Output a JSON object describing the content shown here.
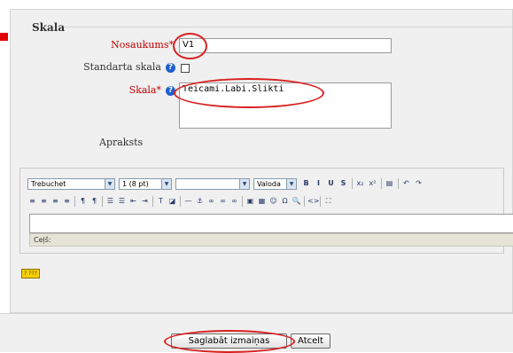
{
  "section": {
    "legend": "Skala"
  },
  "form": {
    "name_label": "Nosaukums",
    "name_value": "V1",
    "standard_label": "Standarta skala",
    "standard_checked": false,
    "scale_label": "Skala",
    "scale_value": "Teicami.Labi.Slikti",
    "description_label": "Apraksts",
    "required_marker": "*",
    "help_glyph": "?"
  },
  "editor": {
    "font_family": "Trebuchet",
    "font_size": "1 (8 pt)",
    "heading": "",
    "language": "Valoda",
    "path_label": "Ceļš:",
    "help_button_label": "? ???",
    "toolbar_row1": [
      {
        "name": "bold-icon",
        "glyph": "B"
      },
      {
        "name": "italic-icon",
        "glyph": "I"
      },
      {
        "name": "underline-icon",
        "glyph": "U"
      },
      {
        "name": "strikethrough-icon",
        "glyph": "S"
      },
      {
        "name": "subscript-icon",
        "glyph": "x₂"
      },
      {
        "name": "superscript-icon",
        "glyph": "x²"
      },
      {
        "name": "clean-word-icon",
        "glyph": "▤"
      },
      {
        "name": "undo-icon",
        "glyph": "↶"
      },
      {
        "name": "redo-icon",
        "glyph": "↷"
      }
    ],
    "toolbar_row2": [
      {
        "name": "align-left-icon",
        "glyph": "≡"
      },
      {
        "name": "align-center-icon",
        "glyph": "≡"
      },
      {
        "name": "align-right-icon",
        "glyph": "≡"
      },
      {
        "name": "justify-icon",
        "glyph": "≡"
      },
      {
        "name": "ltr-icon",
        "glyph": "¶"
      },
      {
        "name": "rtl-icon",
        "glyph": "¶"
      },
      {
        "name": "ordered-list-icon",
        "glyph": "☰"
      },
      {
        "name": "unordered-list-icon",
        "glyph": "☰"
      },
      {
        "name": "outdent-icon",
        "glyph": "⇤"
      },
      {
        "name": "indent-icon",
        "glyph": "⇥"
      },
      {
        "name": "text-color-icon",
        "glyph": "T"
      },
      {
        "name": "background-color-icon",
        "glyph": "◪"
      },
      {
        "name": "horizontal-rule-icon",
        "glyph": "—"
      },
      {
        "name": "anchor-icon",
        "glyph": "⚓"
      },
      {
        "name": "link-icon",
        "glyph": "∞"
      },
      {
        "name": "unlink-icon",
        "glyph": "∞"
      },
      {
        "name": "nolink-icon",
        "glyph": "∞"
      },
      {
        "name": "image-icon",
        "glyph": "▣"
      },
      {
        "name": "table-icon",
        "glyph": "▦"
      },
      {
        "name": "smiley-icon",
        "glyph": "☺"
      },
      {
        "name": "insert-char-icon",
        "glyph": "Ω"
      },
      {
        "name": "search-replace-icon",
        "glyph": "🔍"
      },
      {
        "name": "html-source-icon",
        "glyph": "<>"
      },
      {
        "name": "fullscreen-icon",
        "glyph": "⛶"
      }
    ]
  },
  "buttons": {
    "save": "Saglabāt izmaiņas",
    "cancel": "Atcelt"
  },
  "colors": {
    "annotation_oval": "#d82020",
    "required": "#c00000",
    "help_icon": "#1d5fcf"
  }
}
